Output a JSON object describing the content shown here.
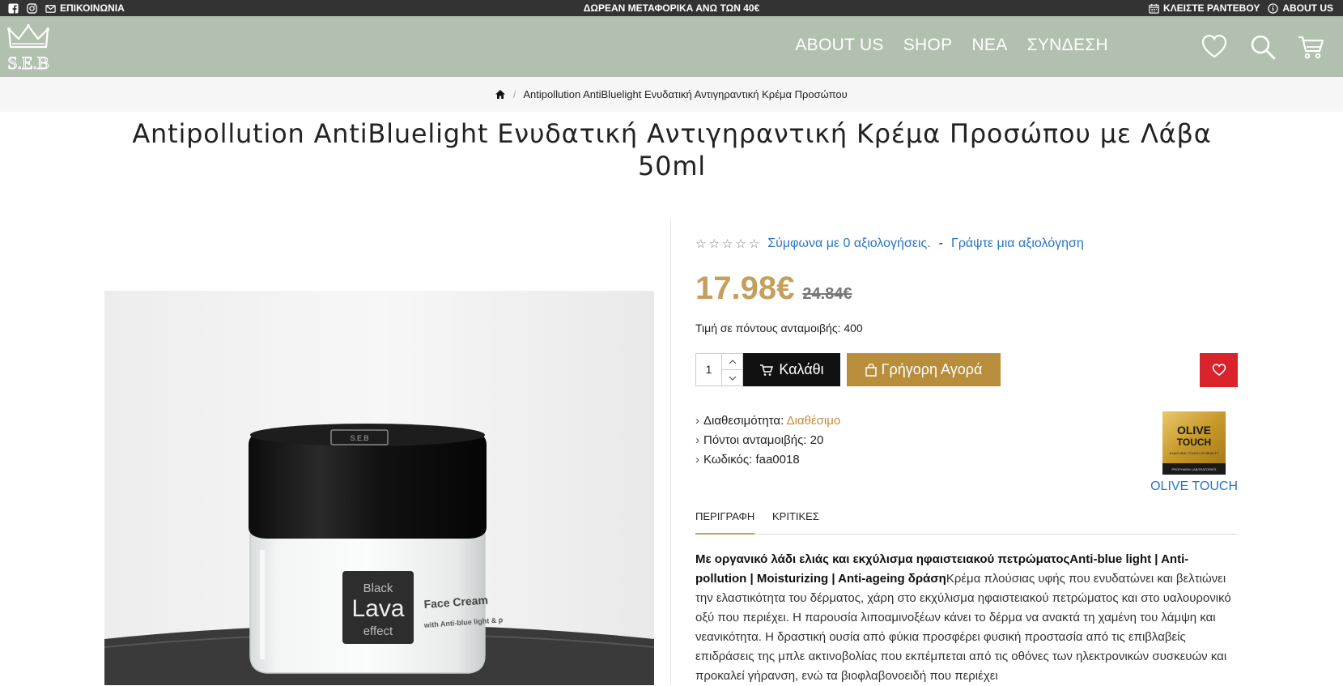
{
  "topbar": {
    "contact_label": "ΕΠΙΚΟΙΝΩΝΙΑ",
    "promo": "ΔΩΡΕΑΝ ΜΕΤΑΦΟΡΙΚΑ ΑΝΩ ΤΩΝ 40€",
    "appointment_label": "ΚΛΕΙΣΤΕ ΡΑΝΤΕΒΟΥ",
    "about_label": "ABOUT US"
  },
  "logo": {
    "text": "S.E.B"
  },
  "nav": {
    "items": [
      "ABOUT US",
      "SHOP",
      "ΝΕΑ",
      "ΣΥΝΔΕΣΗ"
    ]
  },
  "breadcrumb": {
    "current": "Antipollution AntiBluelight Ενυδατική Αντιγηραντική Κρέμα Προσώπου"
  },
  "product": {
    "title": "Antipollution AntiBluelight Ενυδατική Αντιγηραντική Κρέμα Προσώπου με Λάβα 50ml",
    "image": {
      "lid_label": "S.E.B",
      "label_line1": "Black",
      "label_line2": "Lava",
      "label_line3": "effect",
      "face_cream": "Face Cream",
      "subline": "with Anti-blue light & p"
    },
    "reviews_link": "Σύμφωνα με 0 αξιολογήσεις.",
    "reviews_sep": "-",
    "write_review": "Γράψτε μια αξιολόγηση",
    "price_now": "17.98€",
    "price_old": "24.84€",
    "points_price": "Τιμή σε πόντους ανταμοιβής: 400",
    "quantity": "1",
    "cart_label": "Καλάθι",
    "quick_buy_label": "Γρήγορη Αγορά",
    "availability_label": "Διαθεσιμότητα:",
    "availability_value": "Διαθέσιμο",
    "reward_points": "Πόντοι ανταμοιβής: 20",
    "code": "Κωδικός: faa0018",
    "brand": "OLIVE TOUCH",
    "brand_logo_line1": "OLIVE",
    "brand_logo_line2": "TOUCH",
    "brand_logo_sub": "A NATURAL TOUCH OF BEAUTY",
    "brand_logo_footer": "PROPHARM LABORATORIES"
  },
  "tabs": {
    "description": "ΠΕΡΙΓΡΑΦΗ",
    "reviews": "ΚΡΙΤΙΚΕΣ"
  },
  "description": {
    "bold": "Με οργανικό λάδι ελιάς και εκχύλισμα ηφαιστειακού πετρώματοςAnti-blue light | Anti-pollution | Moisturizing | Anti-ageing  δράση",
    "text": "Κρέμα πλούσιας υφής που ενυδατώνει και βελτιώνει την ελαστικότητα του δέρματος, χάρη στο εκχύλισμα ηφαιστειακού πετρώματος και στο υαλουρονικό οξύ που περιέχει. Η παρουσία λιποαμινοξέων κάνει το δέρμα να ανακτά τη χαμένη του λάμψη και νεανικότητα. Η δραστική ουσία από φύκια προσφέρει φυσική προστασία από τις επιβλαβείς επιδράσεις της μπλε ακτινοβολίας που εκπέμπεται από τις οθόνες των ηλεκτρονικών συσκευών και προκαλεί γήρανση, ενώ τα βιοφλαβονοειδή που περιέχει"
  },
  "colors": {
    "header_bg": "#b2c0af",
    "price": "#c59f5c",
    "quick_buy": "#b88d3c",
    "wishlist": "#d8232a",
    "link": "#2a73c5"
  }
}
